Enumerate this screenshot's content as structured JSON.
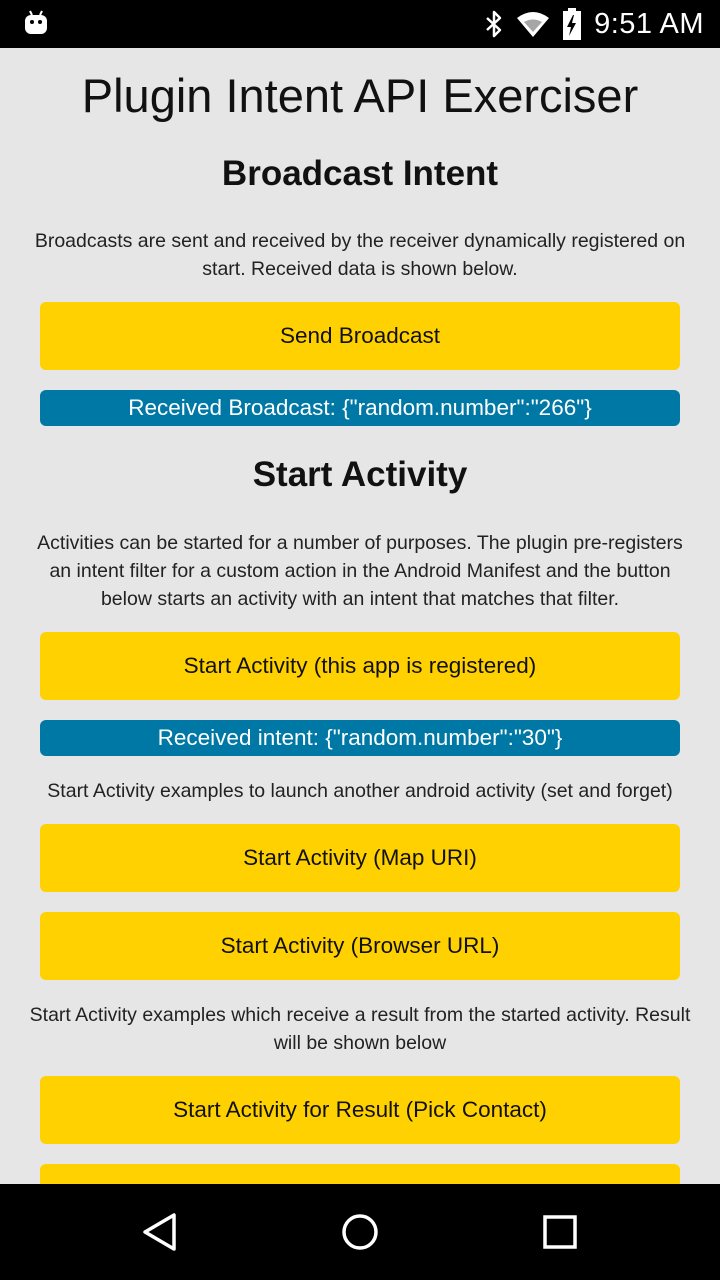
{
  "status_bar": {
    "time": "9:51 AM",
    "icons": [
      "android-icon",
      "bluetooth-icon",
      "wifi-icon",
      "battery-charging-icon"
    ]
  },
  "app": {
    "title": "Plugin Intent API Exerciser"
  },
  "broadcast": {
    "heading": "Broadcast Intent",
    "description": "Broadcasts are sent and received by the receiver dynamically registered on start. Received data is shown below.",
    "button_label": "Send Broadcast",
    "result": "Received Broadcast: {\"random.number\":\"266\"}"
  },
  "activity": {
    "heading": "Start Activity",
    "description": "Activities can be started for a number of purposes. The plugin pre-registers an intent filter for a custom action in the Android Manifest and the button below starts an activity with an intent that matches that filter.",
    "registered_button_label": "Start Activity (this app is registered)",
    "result": "Received intent: {\"random.number\":\"30\"}",
    "launch_description": "Start Activity examples to launch another android activity (set and forget)",
    "map_button_label": "Start Activity (Map URI)",
    "browser_button_label": "Start Activity (Browser URL)",
    "result_description": "Start Activity examples which receive a result from the started activity. Result will be shown below",
    "pick_contact_button_label": "Start Activity for Result (Pick Contact)"
  },
  "nav_bar": {
    "icons": [
      "back-icon",
      "home-icon",
      "recents-icon"
    ]
  },
  "colors": {
    "button": "#ffd100",
    "result_badge": "#0078a5",
    "background": "#e6e6e6"
  }
}
